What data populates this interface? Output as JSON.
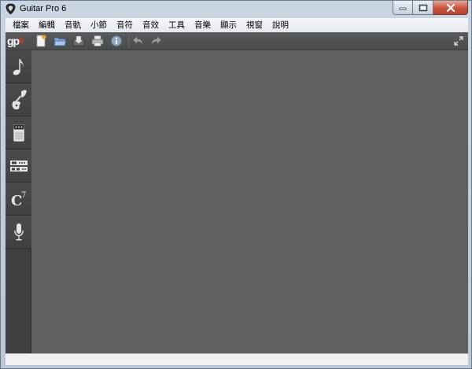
{
  "window": {
    "title": "Guitar Pro 6"
  },
  "menu": {
    "items": [
      "檔案",
      "編輯",
      "音軌",
      "小節",
      "音符",
      "音效",
      "工具",
      "音樂",
      "顯示",
      "視窗",
      "說明"
    ]
  },
  "toolbar": {
    "logo": "gp",
    "logo_version": "6",
    "buttons": [
      {
        "name": "new-file",
        "icon": "new-document-icon"
      },
      {
        "name": "open-file",
        "icon": "open-folder-icon"
      },
      {
        "name": "save-file",
        "icon": "save-icon"
      },
      {
        "name": "print",
        "icon": "printer-icon"
      },
      {
        "name": "info",
        "icon": "info-icon"
      },
      {
        "name": "undo",
        "icon": "undo-icon"
      },
      {
        "name": "redo",
        "icon": "redo-icon"
      }
    ]
  },
  "sidebar": {
    "panels": [
      {
        "name": "notation",
        "icon": "music-note-icon"
      },
      {
        "name": "instrument",
        "icon": "guitar-icon"
      },
      {
        "name": "amp",
        "icon": "amplifier-icon"
      },
      {
        "name": "mixer",
        "icon": "rack-effects-icon"
      },
      {
        "name": "chord",
        "icon": "chord-icon",
        "label": "C",
        "superscript": "7"
      },
      {
        "name": "microphone",
        "icon": "microphone-icon"
      }
    ]
  },
  "colors": {
    "workspace": "#5f6161",
    "toolbar": "#525454",
    "sidebar": "#3e4040",
    "accent_red": "#e0342a"
  }
}
